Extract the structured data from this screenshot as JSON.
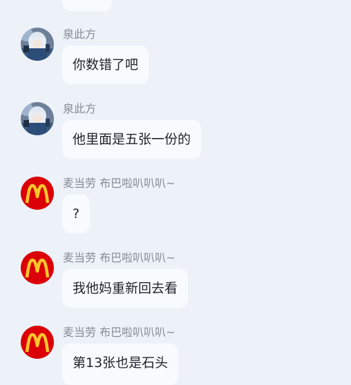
{
  "colors": {
    "background": "#edf2f9",
    "bubble": "#f8fbfe",
    "sender_text": "#858b94",
    "message_text": "#1f2329",
    "mcd_red": "#db0007",
    "mcd_yellow": "#ffc72c"
  },
  "messages": [
    {
      "sender": "泉此方",
      "avatar": "anime-avatar-icon",
      "text": "你数错了吧"
    },
    {
      "sender": "泉此方",
      "avatar": "anime-avatar-icon",
      "text": "他里面是五张一份的"
    },
    {
      "sender": "麦当劳 布巴啦叭叭叭~",
      "avatar": "mcdonalds-logo-icon",
      "text": "?"
    },
    {
      "sender": "麦当劳 布巴啦叭叭叭~",
      "avatar": "mcdonalds-logo-icon",
      "text": "我他妈重新回去看"
    },
    {
      "sender": "麦当劳 布巴啦叭叭叭~",
      "avatar": "mcdonalds-logo-icon",
      "text": "第13张也是石头"
    }
  ]
}
